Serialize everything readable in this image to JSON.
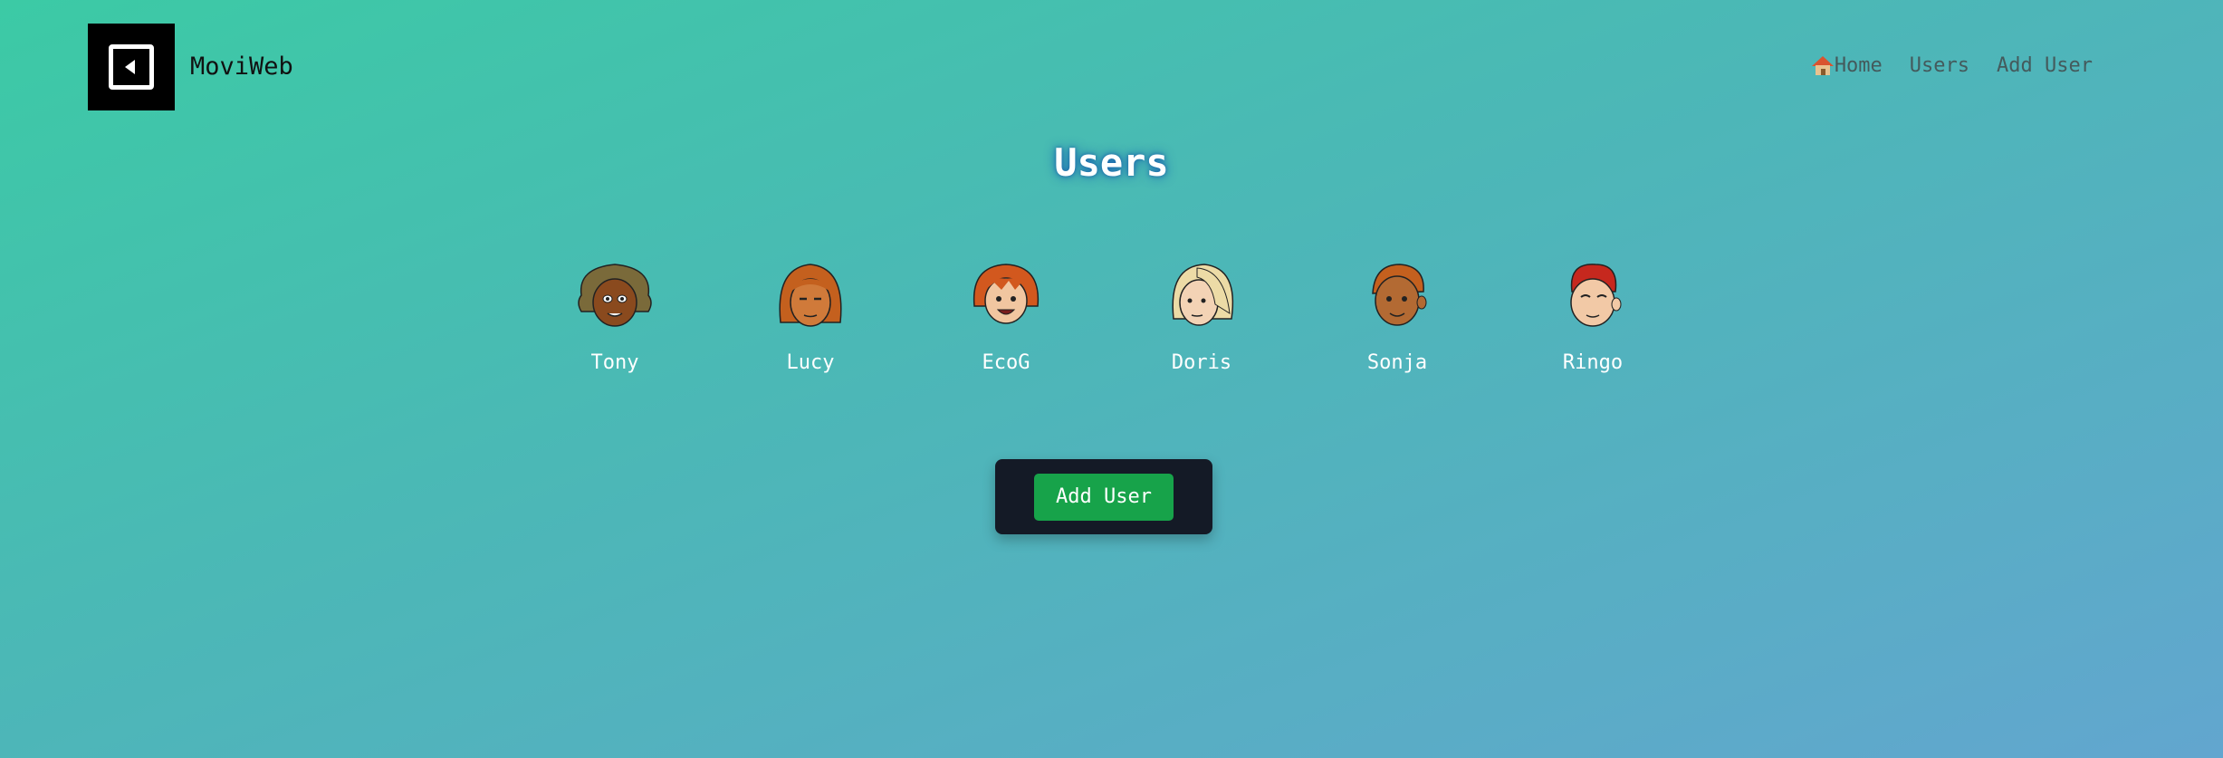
{
  "header": {
    "brand": "MoviWeb",
    "nav": [
      {
        "label": "Home",
        "icon": "house-icon"
      },
      {
        "label": "Users"
      },
      {
        "label": "Add User"
      }
    ]
  },
  "main": {
    "title": "Users",
    "users": [
      {
        "name": "Tony",
        "skin": "#8a4a1e",
        "hair": "#7a6a3a"
      },
      {
        "name": "Lucy",
        "skin": "#d07a3a",
        "hair": "#c4601e"
      },
      {
        "name": "EcoG",
        "skin": "#f1c6a0",
        "hair": "#d2581e"
      },
      {
        "name": "Doris",
        "skin": "#f3d3b5",
        "hair": "#ecdba6"
      },
      {
        "name": "Sonja",
        "skin": "#b36a33",
        "hair": "#c4601e"
      },
      {
        "name": "Ringo",
        "skin": "#f2c9a6",
        "hair": "#c6281e"
      }
    ],
    "add_button": "Add User"
  },
  "colors": {
    "accent": "#17a34a",
    "panel": "#141a26",
    "bg_start": "#3ccaa5",
    "bg_end": "#62a6cf"
  }
}
